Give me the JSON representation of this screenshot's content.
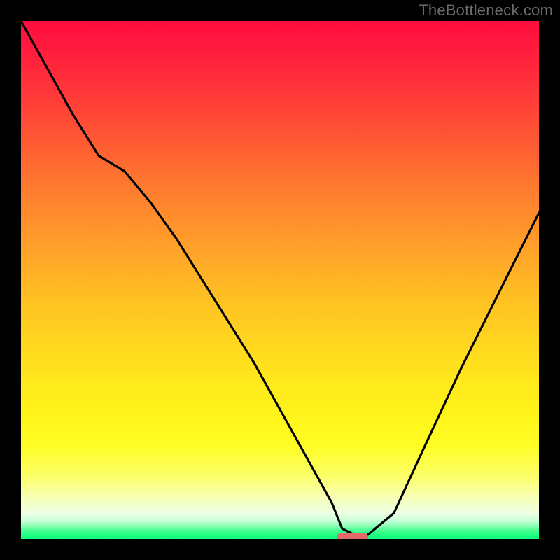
{
  "attribution": "TheBottleneck.com",
  "chart_data": {
    "type": "line",
    "title": "",
    "xlabel": "",
    "ylabel": "",
    "xlim": [
      0,
      100
    ],
    "ylim": [
      0,
      100
    ],
    "grid": false,
    "series": [
      {
        "name": "bottleneck-curve",
        "x": [
          0,
          5,
          10,
          15,
          20,
          25,
          30,
          35,
          40,
          45,
          50,
          55,
          60,
          62,
          66,
          72,
          78,
          85,
          92,
          100
        ],
        "values": [
          100,
          91,
          82,
          74,
          71,
          65,
          58,
          50,
          42,
          34,
          25,
          16,
          7,
          2,
          0,
          5,
          18,
          33,
          47,
          63
        ]
      }
    ],
    "marker": {
      "x_start": 61,
      "x_end": 67,
      "y": 0
    },
    "gradient": {
      "top_color": "#ff0d3e",
      "mid_color": "#ffe91c",
      "bottom_color": "#0aff79"
    }
  }
}
